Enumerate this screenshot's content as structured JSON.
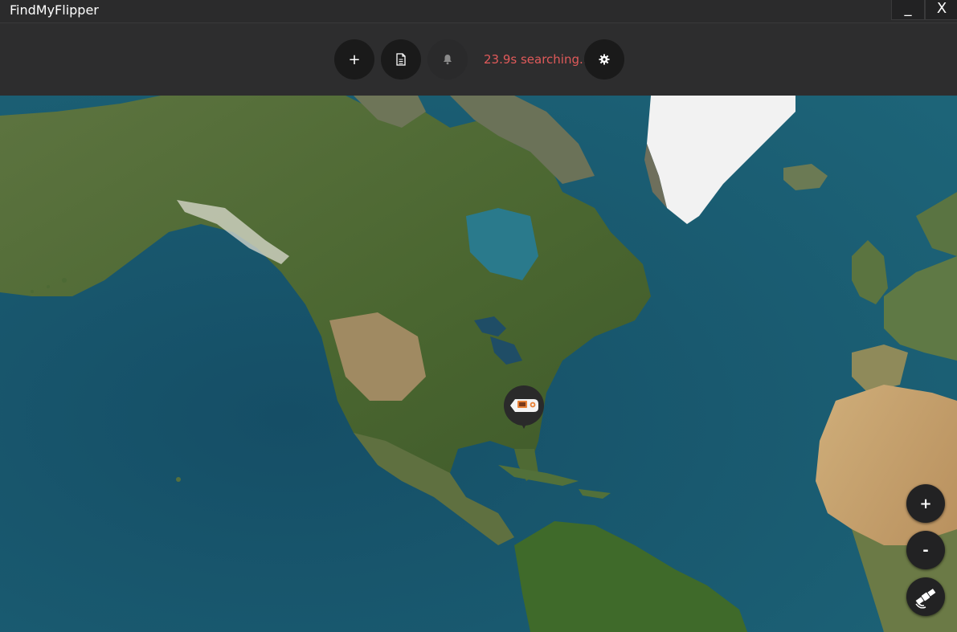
{
  "window": {
    "title": "FindMyFlipper",
    "minimize_label": "_",
    "close_label": "X"
  },
  "toolbar": {
    "add_label": "+",
    "status_text": "23.9s searching...",
    "icons": [
      "plus-icon",
      "document-icon",
      "bell-icon",
      "gear-icon"
    ]
  },
  "map": {
    "zoom_in_label": "+",
    "zoom_out_label": "-",
    "layer_icon": "satellite-icon",
    "marker_icon": "flipper-device-icon"
  },
  "colors": {
    "status": "#e05a5a",
    "ocean": "#1a5a6e",
    "land": "#4d6a35",
    "ice": "#f2f2f2",
    "desert": "#c7a371"
  }
}
